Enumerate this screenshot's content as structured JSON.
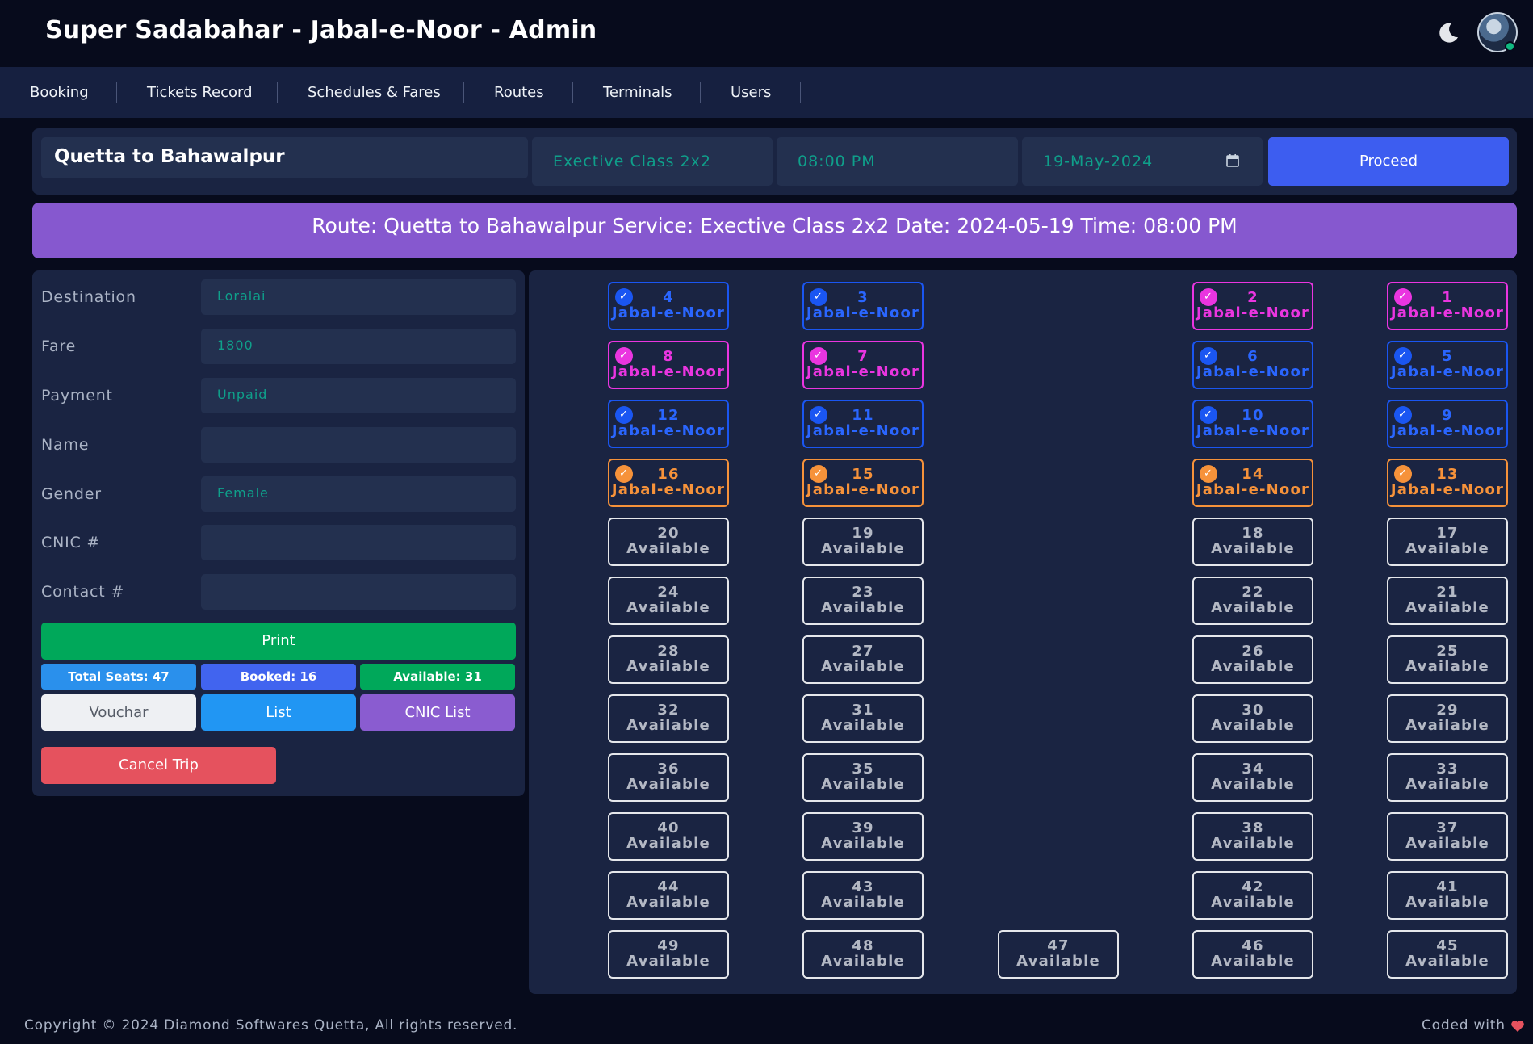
{
  "header": {
    "title": "Super Sadabahar - Jabal-e-Noor - Admin",
    "theme_icon": "moon-icon",
    "avatar": "user-avatar"
  },
  "nav": {
    "items": [
      "Booking",
      "Tickets Record",
      "Schedules & Fares",
      "Routes",
      "Terminals",
      "Users"
    ]
  },
  "search": {
    "route": "Quetta to Bahawalpur",
    "service_class": "Exective Class 2x2",
    "time": "08:00 PM",
    "date": "19-May-2024",
    "proceed_label": "Proceed"
  },
  "banner": {
    "text": "Route: Quetta to Bahawalpur Service: Exective Class 2x2 Date: 2024-05-19 Time: 08:00 PM"
  },
  "form": {
    "fields": [
      {
        "label": "Destination",
        "value": "Loralai"
      },
      {
        "label": "Fare",
        "value": "1800"
      },
      {
        "label": "Payment",
        "value": "Unpaid"
      },
      {
        "label": "Name",
        "value": ""
      },
      {
        "label": "Gender",
        "value": "Female"
      },
      {
        "label": "CNIC #",
        "value": ""
      },
      {
        "label": "Contact #",
        "value": ""
      }
    ],
    "print_label": "Print",
    "stats": {
      "total": "Total Seats: 47",
      "booked": "Booked: 16",
      "available": "Available: 31"
    },
    "buttons": {
      "vouchar": "Vouchar",
      "list": "List",
      "cnic_list": "CNIC List",
      "cancel": "Cancel Trip"
    }
  },
  "seats": [
    {
      "num": "4",
      "label": "Jabal-e-Noor",
      "status": "blue"
    },
    {
      "num": "3",
      "label": "Jabal-e-Noor",
      "status": "blue"
    },
    {
      "num": "2",
      "label": "Jabal-e-Noor",
      "status": "pink"
    },
    {
      "num": "1",
      "label": "Jabal-e-Noor",
      "status": "pink"
    },
    {
      "num": "8",
      "label": "Jabal-e-Noor",
      "status": "pink"
    },
    {
      "num": "7",
      "label": "Jabal-e-Noor",
      "status": "pink"
    },
    {
      "num": "6",
      "label": "Jabal-e-Noor",
      "status": "blue"
    },
    {
      "num": "5",
      "label": "Jabal-e-Noor",
      "status": "blue"
    },
    {
      "num": "12",
      "label": "Jabal-e-Noor",
      "status": "blue"
    },
    {
      "num": "11",
      "label": "Jabal-e-Noor",
      "status": "blue"
    },
    {
      "num": "10",
      "label": "Jabal-e-Noor",
      "status": "blue"
    },
    {
      "num": "9",
      "label": "Jabal-e-Noor",
      "status": "blue"
    },
    {
      "num": "16",
      "label": "Jabal-e-Noor",
      "status": "orange"
    },
    {
      "num": "15",
      "label": "Jabal-e-Noor",
      "status": "orange"
    },
    {
      "num": "14",
      "label": "Jabal-e-Noor",
      "status": "orange"
    },
    {
      "num": "13",
      "label": "Jabal-e-Noor",
      "status": "orange"
    },
    {
      "num": "20",
      "label": "Available",
      "status": "available"
    },
    {
      "num": "19",
      "label": "Available",
      "status": "available"
    },
    {
      "num": "18",
      "label": "Available",
      "status": "available"
    },
    {
      "num": "17",
      "label": "Available",
      "status": "available"
    },
    {
      "num": "24",
      "label": "Available",
      "status": "available"
    },
    {
      "num": "23",
      "label": "Available",
      "status": "available"
    },
    {
      "num": "22",
      "label": "Available",
      "status": "available"
    },
    {
      "num": "21",
      "label": "Available",
      "status": "available"
    },
    {
      "num": "28",
      "label": "Available",
      "status": "available"
    },
    {
      "num": "27",
      "label": "Available",
      "status": "available"
    },
    {
      "num": "26",
      "label": "Available",
      "status": "available"
    },
    {
      "num": "25",
      "label": "Available",
      "status": "available"
    },
    {
      "num": "32",
      "label": "Available",
      "status": "available"
    },
    {
      "num": "31",
      "label": "Available",
      "status": "available"
    },
    {
      "num": "30",
      "label": "Available",
      "status": "available"
    },
    {
      "num": "29",
      "label": "Available",
      "status": "available"
    },
    {
      "num": "36",
      "label": "Available",
      "status": "available"
    },
    {
      "num": "35",
      "label": "Available",
      "status": "available"
    },
    {
      "num": "34",
      "label": "Available",
      "status": "available"
    },
    {
      "num": "33",
      "label": "Available",
      "status": "available"
    },
    {
      "num": "40",
      "label": "Available",
      "status": "available"
    },
    {
      "num": "39",
      "label": "Available",
      "status": "available"
    },
    {
      "num": "38",
      "label": "Available",
      "status": "available"
    },
    {
      "num": "37",
      "label": "Available",
      "status": "available"
    },
    {
      "num": "44",
      "label": "Available",
      "status": "available"
    },
    {
      "num": "43",
      "label": "Available",
      "status": "available"
    },
    {
      "num": "42",
      "label": "Available",
      "status": "available"
    },
    {
      "num": "41",
      "label": "Available",
      "status": "available"
    },
    {
      "num": "49",
      "label": "Available",
      "status": "available"
    },
    {
      "num": "48",
      "label": "Available",
      "status": "available"
    },
    {
      "num": "47",
      "label": "Available",
      "status": "available"
    },
    {
      "num": "46",
      "label": "Available",
      "status": "available"
    },
    {
      "num": "45",
      "label": "Available",
      "status": "available"
    }
  ],
  "footer": {
    "copyright": "Copyright © 2024 Diamond Softwares Quetta, All rights reserved.",
    "coded_with": "Coded with",
    "heart_icon": "heart-icon"
  },
  "colors": {
    "background": "#070b1c",
    "panel": "#1a2442",
    "accent_blue": "#3d5df0",
    "banner_purple": "#8658cf",
    "print_green": "#00a85a",
    "cancel_red": "#e5525e",
    "seat_blue": "#1a56f2",
    "seat_pink": "#ea35e0",
    "seat_orange": "#f6923a"
  }
}
